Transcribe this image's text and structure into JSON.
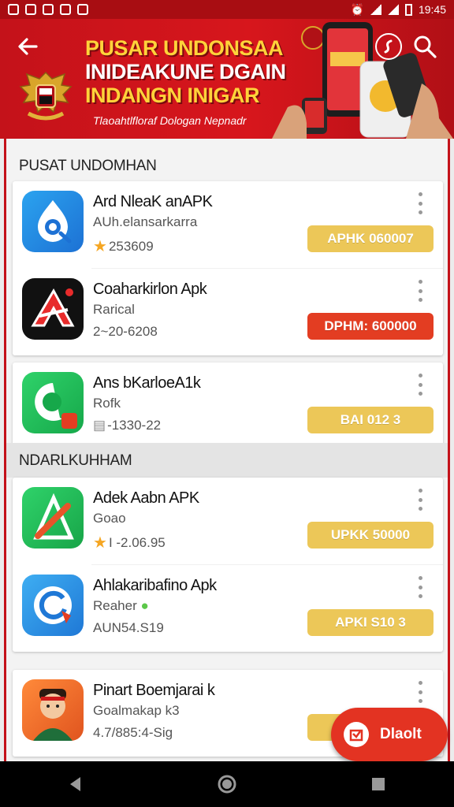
{
  "status": {
    "time": "19:45"
  },
  "banner": {
    "title_line1": "PUSAR UNDONSAA",
    "title_line2": "INIDEAKUNE DGAIN",
    "title_line3": "INDANGN INIGAR",
    "subtitle": "Tlaoahtlfloraf Dologan Nepnadr"
  },
  "sections": [
    {
      "title": "PUSAT UNDOMHAN",
      "cards": [
        [
          {
            "name": "Ard NleaK anAPK",
            "developer": "AUh.elansarkarra",
            "meta": "253609",
            "has_star": true,
            "button": "APHK 060007",
            "button_color": "#ecc758",
            "icon": "shield-drop-icon"
          },
          {
            "name": "Coaharkirlon Apk",
            "developer": "Rarical",
            "meta": "2~20-6208",
            "has_star": false,
            "button": "DPHM: 600000",
            "button_color": "#e33d22",
            "icon": "red-a-logo-icon"
          }
        ],
        [
          {
            "name": "Ans bKarloeA1k",
            "developer": "Rofk",
            "meta": "-1330-22",
            "has_star": false,
            "button": "BAI 012 3",
            "button_color": "#ecc758",
            "icon": "green-chat-icon"
          }
        ]
      ]
    },
    {
      "title": "NDARLKUHHAM",
      "cards": [
        [
          {
            "name": "Adek Aabn APK",
            "developer": "Goao",
            "meta": "I -2.06.95",
            "has_star": true,
            "button": "UPKK 50000",
            "button_color": "#ecc758",
            "icon": "green-pencil-icon"
          },
          {
            "name": "Ahlakaribafino Apk",
            "developer": "Reaher",
            "meta": "AUN54.S19",
            "has_star": false,
            "button": "APKI S10 3",
            "button_color": "#ecc758",
            "icon": "blue-refresh-icon"
          }
        ],
        [
          {
            "name": "Pinart Boemjarai k",
            "developer": "Goalmakap k3",
            "meta": "4.7/885:4-Sig",
            "has_star": false,
            "button": "",
            "button_color": "#ecc758",
            "icon": "avatar-icon"
          }
        ]
      ]
    }
  ],
  "fab": {
    "label": "Dlaolt"
  }
}
